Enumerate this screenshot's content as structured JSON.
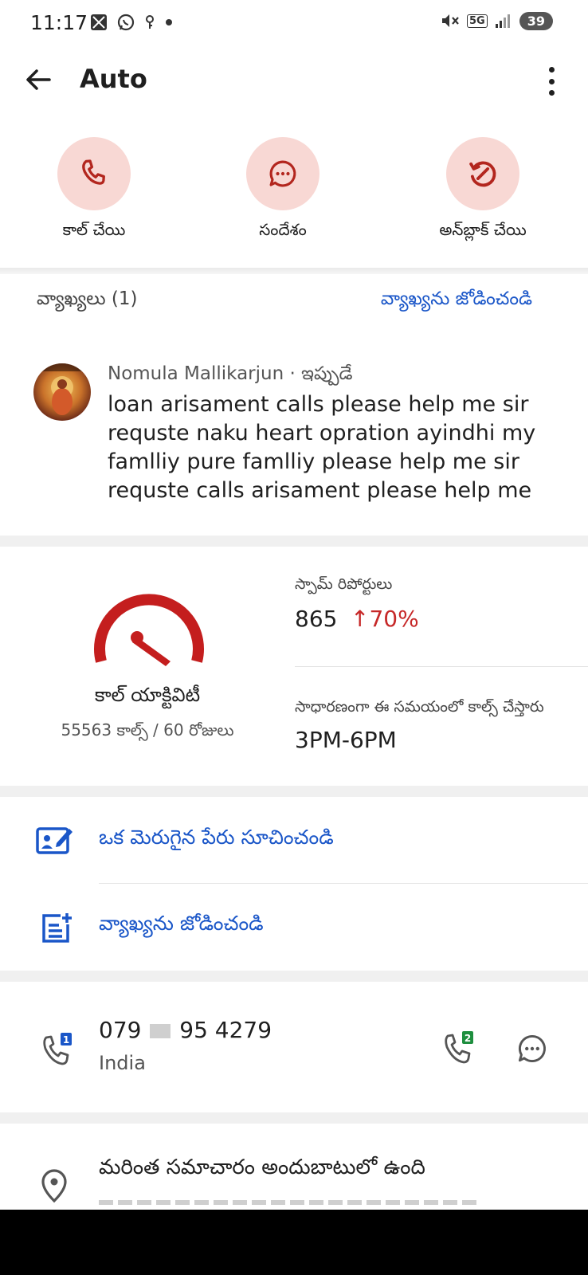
{
  "status_bar": {
    "time": "11:17",
    "battery": "39",
    "network": "5G"
  },
  "app_bar": {
    "title": "Auto"
  },
  "actions": [
    {
      "label": "కాల్ చేయి",
      "icon": "phone-icon"
    },
    {
      "label": "సందేశం",
      "icon": "chat-bubble-icon"
    },
    {
      "label": "అన్‌బ్లాక్ చేయి",
      "icon": "unblock-icon"
    }
  ],
  "comments": {
    "header": "వ్యాఖ్యలు (1)",
    "add_link": "వ్యాఖ్యను జోడించండి",
    "items": [
      {
        "author_line": "Nomula Mallikarjun · ఇప్పుడే",
        "body": "loan arisament calls please help me sir requste naku heart opration ayindhi my famlliy pure famlliy please help me sir requste  calls arisament please help me"
      }
    ]
  },
  "activity": {
    "label": "కాల్ యాక్టివిటీ",
    "sub": "55563 కాల్స్ / 60 రోజులు",
    "spam_label": "స్పామ్ రిపోర్టులు",
    "spam_count": "865",
    "spam_change": "↑70%",
    "usual_label": "సాధారణంగా ఈ సమయంలో కాల్స్ చేస్తారు",
    "usual_value": "3PM-6PM"
  },
  "options": {
    "suggest_name": "ఒక మెరుగైన పేరు సూచించండి",
    "add_comment": "వ్యాఖ్యను జోడించండి"
  },
  "phone": {
    "number_prefix": "079",
    "number_suffix": "95 4279",
    "country": "India",
    "sim1": "1",
    "sim2": "2"
  },
  "more_info": {
    "title": "మరింత సమాచారం అందుబాటులో ఉంది"
  },
  "colors": {
    "accent_blue": "#1a56c8",
    "danger_red": "#c62828",
    "action_circle": "#f8d8d4",
    "gauge_red": "#c41e1e",
    "sim_badge_blue": "#1a56c8",
    "sim_badge_green": "#1e8e3e"
  }
}
